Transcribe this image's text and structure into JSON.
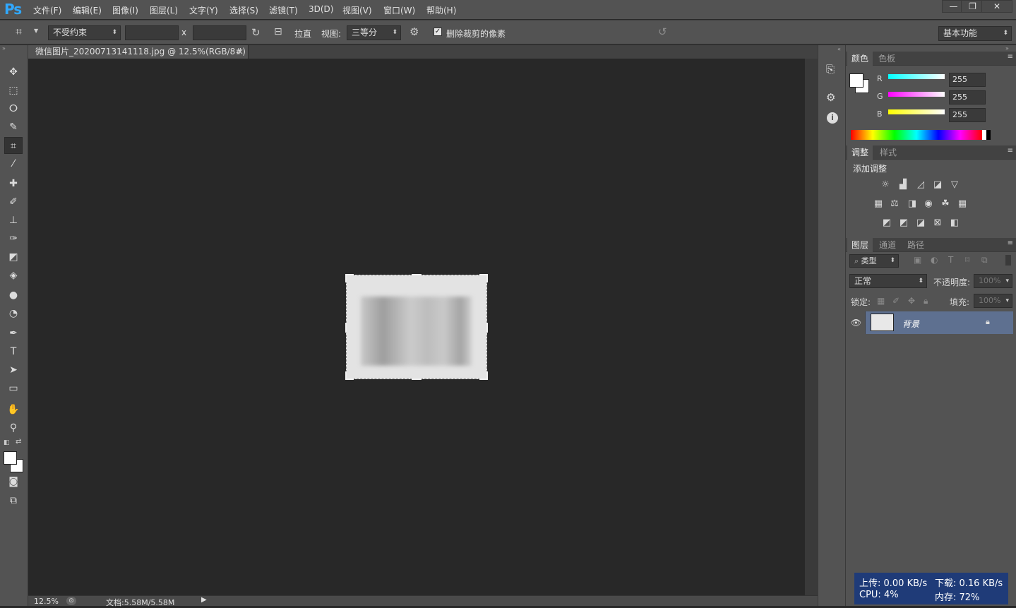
{
  "app": {
    "logo": "Ps"
  },
  "menu": [
    "文件(F)",
    "编辑(E)",
    "图像(I)",
    "图层(L)",
    "文字(Y)",
    "选择(S)",
    "滤镜(T)",
    "3D(D)",
    "视图(V)",
    "窗口(W)",
    "帮助(H)"
  ],
  "window_controls": {
    "minimize": "—",
    "restore": "❐",
    "close": "✕"
  },
  "options": {
    "ratio": "不受约束",
    "x_sep": "x",
    "straighten": "拉直",
    "view_label": "视图:",
    "view_value": "三等分",
    "delete_cropped": "删除裁剪的像素",
    "delete_cropped_checked": true,
    "workspace": "基本功能"
  },
  "document": {
    "tab_title": "微信图片_20200713141118.jpg @ 12.5%(RGB/8#) *",
    "tab_close": "×"
  },
  "status": {
    "zoom": "12.5%",
    "doc_info": "文档:5.58M/5.58M"
  },
  "color_panel": {
    "tabs": [
      "颜色",
      "色板"
    ],
    "r_label": "R",
    "g_label": "G",
    "b_label": "B",
    "r": "255",
    "g": "255",
    "b": "255"
  },
  "adjust_panel": {
    "tabs": [
      "调整",
      "样式"
    ],
    "title": "添加调整"
  },
  "layers_panel": {
    "tabs": [
      "图层",
      "通道",
      "路径"
    ],
    "filter_kind": "类型",
    "blend_mode": "正常",
    "opacity_label": "不透明度:",
    "opacity_value": "100%",
    "lock_label": "锁定:",
    "fill_label": "填充:",
    "fill_value": "100%",
    "layers": [
      {
        "name": "背景",
        "visible": true,
        "locked": true
      }
    ]
  },
  "net_monitor": {
    "upload": "上传: 0.00 KB/s",
    "download": "下载: 0.16 KB/s",
    "cpu": "CPU: 4%",
    "memory": "内存: 72%"
  }
}
